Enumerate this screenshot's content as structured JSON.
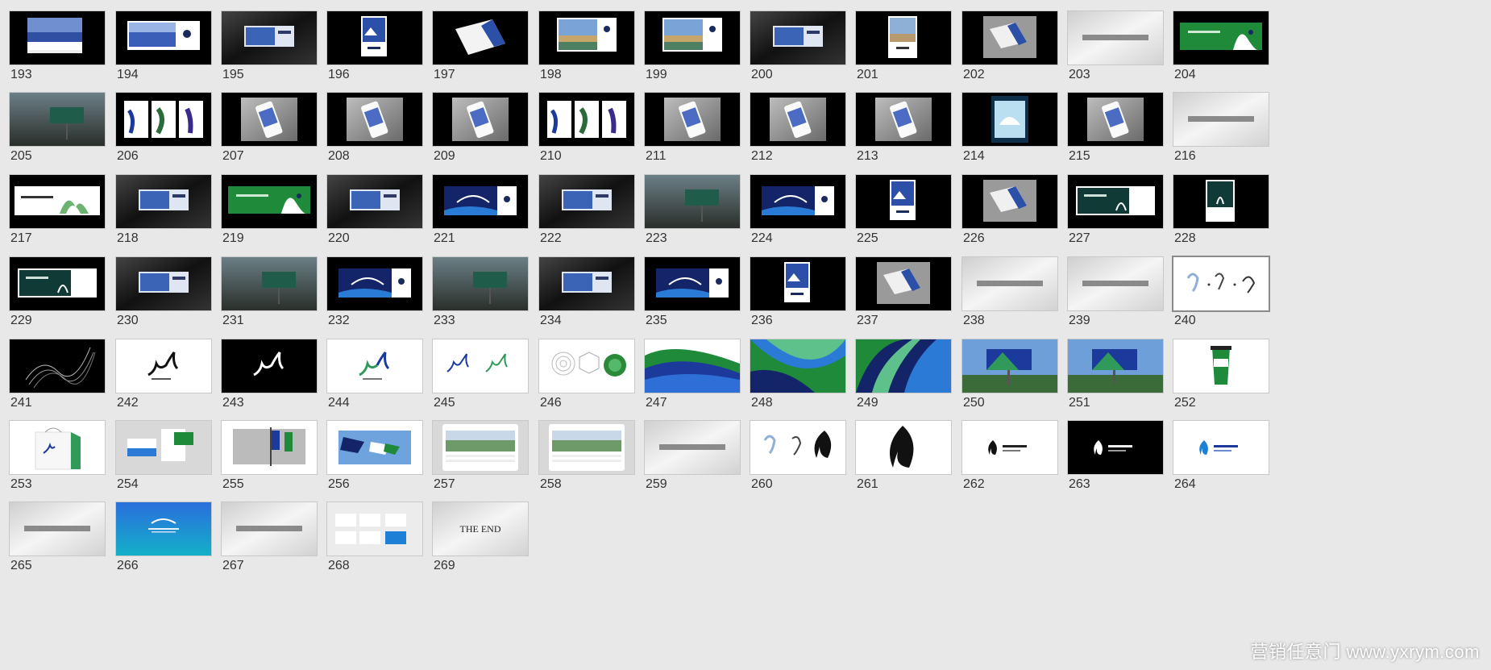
{
  "watermark": "营销任意门 www.yxrym.com",
  "selected_slide": "240",
  "end_text": "THE END",
  "slides": [
    {
      "n": "193",
      "kind": "photo-sky"
    },
    {
      "n": "194",
      "kind": "banner-blue"
    },
    {
      "n": "195",
      "kind": "billboard-dark"
    },
    {
      "n": "196",
      "kind": "poster-blue"
    },
    {
      "n": "197",
      "kind": "card-angle"
    },
    {
      "n": "198",
      "kind": "landscape"
    },
    {
      "n": "199",
      "kind": "landscape"
    },
    {
      "n": "200",
      "kind": "billboard-dark"
    },
    {
      "n": "201",
      "kind": "poster-lake"
    },
    {
      "n": "202",
      "kind": "card-gray"
    },
    {
      "n": "203",
      "kind": "section-title"
    },
    {
      "n": "204",
      "kind": "green-banner"
    },
    {
      "n": "205",
      "kind": "billboard-outdoor"
    },
    {
      "n": "206",
      "kind": "three-posters"
    },
    {
      "n": "207",
      "kind": "phone"
    },
    {
      "n": "208",
      "kind": "phone"
    },
    {
      "n": "209",
      "kind": "phone"
    },
    {
      "n": "210",
      "kind": "three-posters"
    },
    {
      "n": "211",
      "kind": "phone"
    },
    {
      "n": "212",
      "kind": "phone"
    },
    {
      "n": "213",
      "kind": "phone"
    },
    {
      "n": "214",
      "kind": "poster-teal"
    },
    {
      "n": "215",
      "kind": "phone"
    },
    {
      "n": "216",
      "kind": "section-title"
    },
    {
      "n": "217",
      "kind": "white-banner"
    },
    {
      "n": "218",
      "kind": "billboard-dark"
    },
    {
      "n": "219",
      "kind": "green-banner"
    },
    {
      "n": "220",
      "kind": "billboard-dark"
    },
    {
      "n": "221",
      "kind": "banner-blue-crane"
    },
    {
      "n": "222",
      "kind": "billboard-dark"
    },
    {
      "n": "223",
      "kind": "billboard-outdoor"
    },
    {
      "n": "224",
      "kind": "banner-blue-crane"
    },
    {
      "n": "225",
      "kind": "poster-blue"
    },
    {
      "n": "226",
      "kind": "card-gray"
    },
    {
      "n": "227",
      "kind": "dark-green-banner"
    },
    {
      "n": "228",
      "kind": "poster-dark"
    },
    {
      "n": "229",
      "kind": "dark-green-banner"
    },
    {
      "n": "230",
      "kind": "billboard-dark"
    },
    {
      "n": "231",
      "kind": "billboard-outdoor"
    },
    {
      "n": "232",
      "kind": "banner-blue-crane"
    },
    {
      "n": "233",
      "kind": "billboard-outdoor"
    },
    {
      "n": "234",
      "kind": "billboard-dark"
    },
    {
      "n": "235",
      "kind": "banner-blue-crane"
    },
    {
      "n": "236",
      "kind": "poster-blue"
    },
    {
      "n": "237",
      "kind": "card-gray"
    },
    {
      "n": "238",
      "kind": "section-title"
    },
    {
      "n": "239",
      "kind": "section-title"
    },
    {
      "n": "240",
      "kind": "sketch-icons"
    },
    {
      "n": "241",
      "kind": "black-lines"
    },
    {
      "n": "242",
      "kind": "logo-white"
    },
    {
      "n": "243",
      "kind": "logo-black"
    },
    {
      "n": "244",
      "kind": "logo-white-color"
    },
    {
      "n": "245",
      "kind": "logo-pair"
    },
    {
      "n": "246",
      "kind": "logo-construct"
    },
    {
      "n": "247",
      "kind": "pattern-1"
    },
    {
      "n": "248",
      "kind": "pattern-2"
    },
    {
      "n": "249",
      "kind": "pattern-3"
    },
    {
      "n": "250",
      "kind": "billboard-sky"
    },
    {
      "n": "251",
      "kind": "billboard-sky"
    },
    {
      "n": "252",
      "kind": "cup"
    },
    {
      "n": "253",
      "kind": "bag"
    },
    {
      "n": "254",
      "kind": "stationery"
    },
    {
      "n": "255",
      "kind": "flags-street"
    },
    {
      "n": "256",
      "kind": "flags-sky"
    },
    {
      "n": "257",
      "kind": "website"
    },
    {
      "n": "258",
      "kind": "website"
    },
    {
      "n": "259",
      "kind": "section-title"
    },
    {
      "n": "260",
      "kind": "sketch-flame"
    },
    {
      "n": "261",
      "kind": "flame-big"
    },
    {
      "n": "262",
      "kind": "flame-logo-white"
    },
    {
      "n": "263",
      "kind": "flame-logo-black"
    },
    {
      "n": "264",
      "kind": "flame-logo-blue"
    },
    {
      "n": "265",
      "kind": "section-title"
    },
    {
      "n": "266",
      "kind": "gradient-blue"
    },
    {
      "n": "267",
      "kind": "section-title"
    },
    {
      "n": "268",
      "kind": "summary"
    },
    {
      "n": "269",
      "kind": "the-end"
    }
  ],
  "colors": {
    "background": "#e8e8e8",
    "brand_blue": "#1b3a9c",
    "brand_green": "#1f8a3a",
    "navy": "#142468"
  }
}
